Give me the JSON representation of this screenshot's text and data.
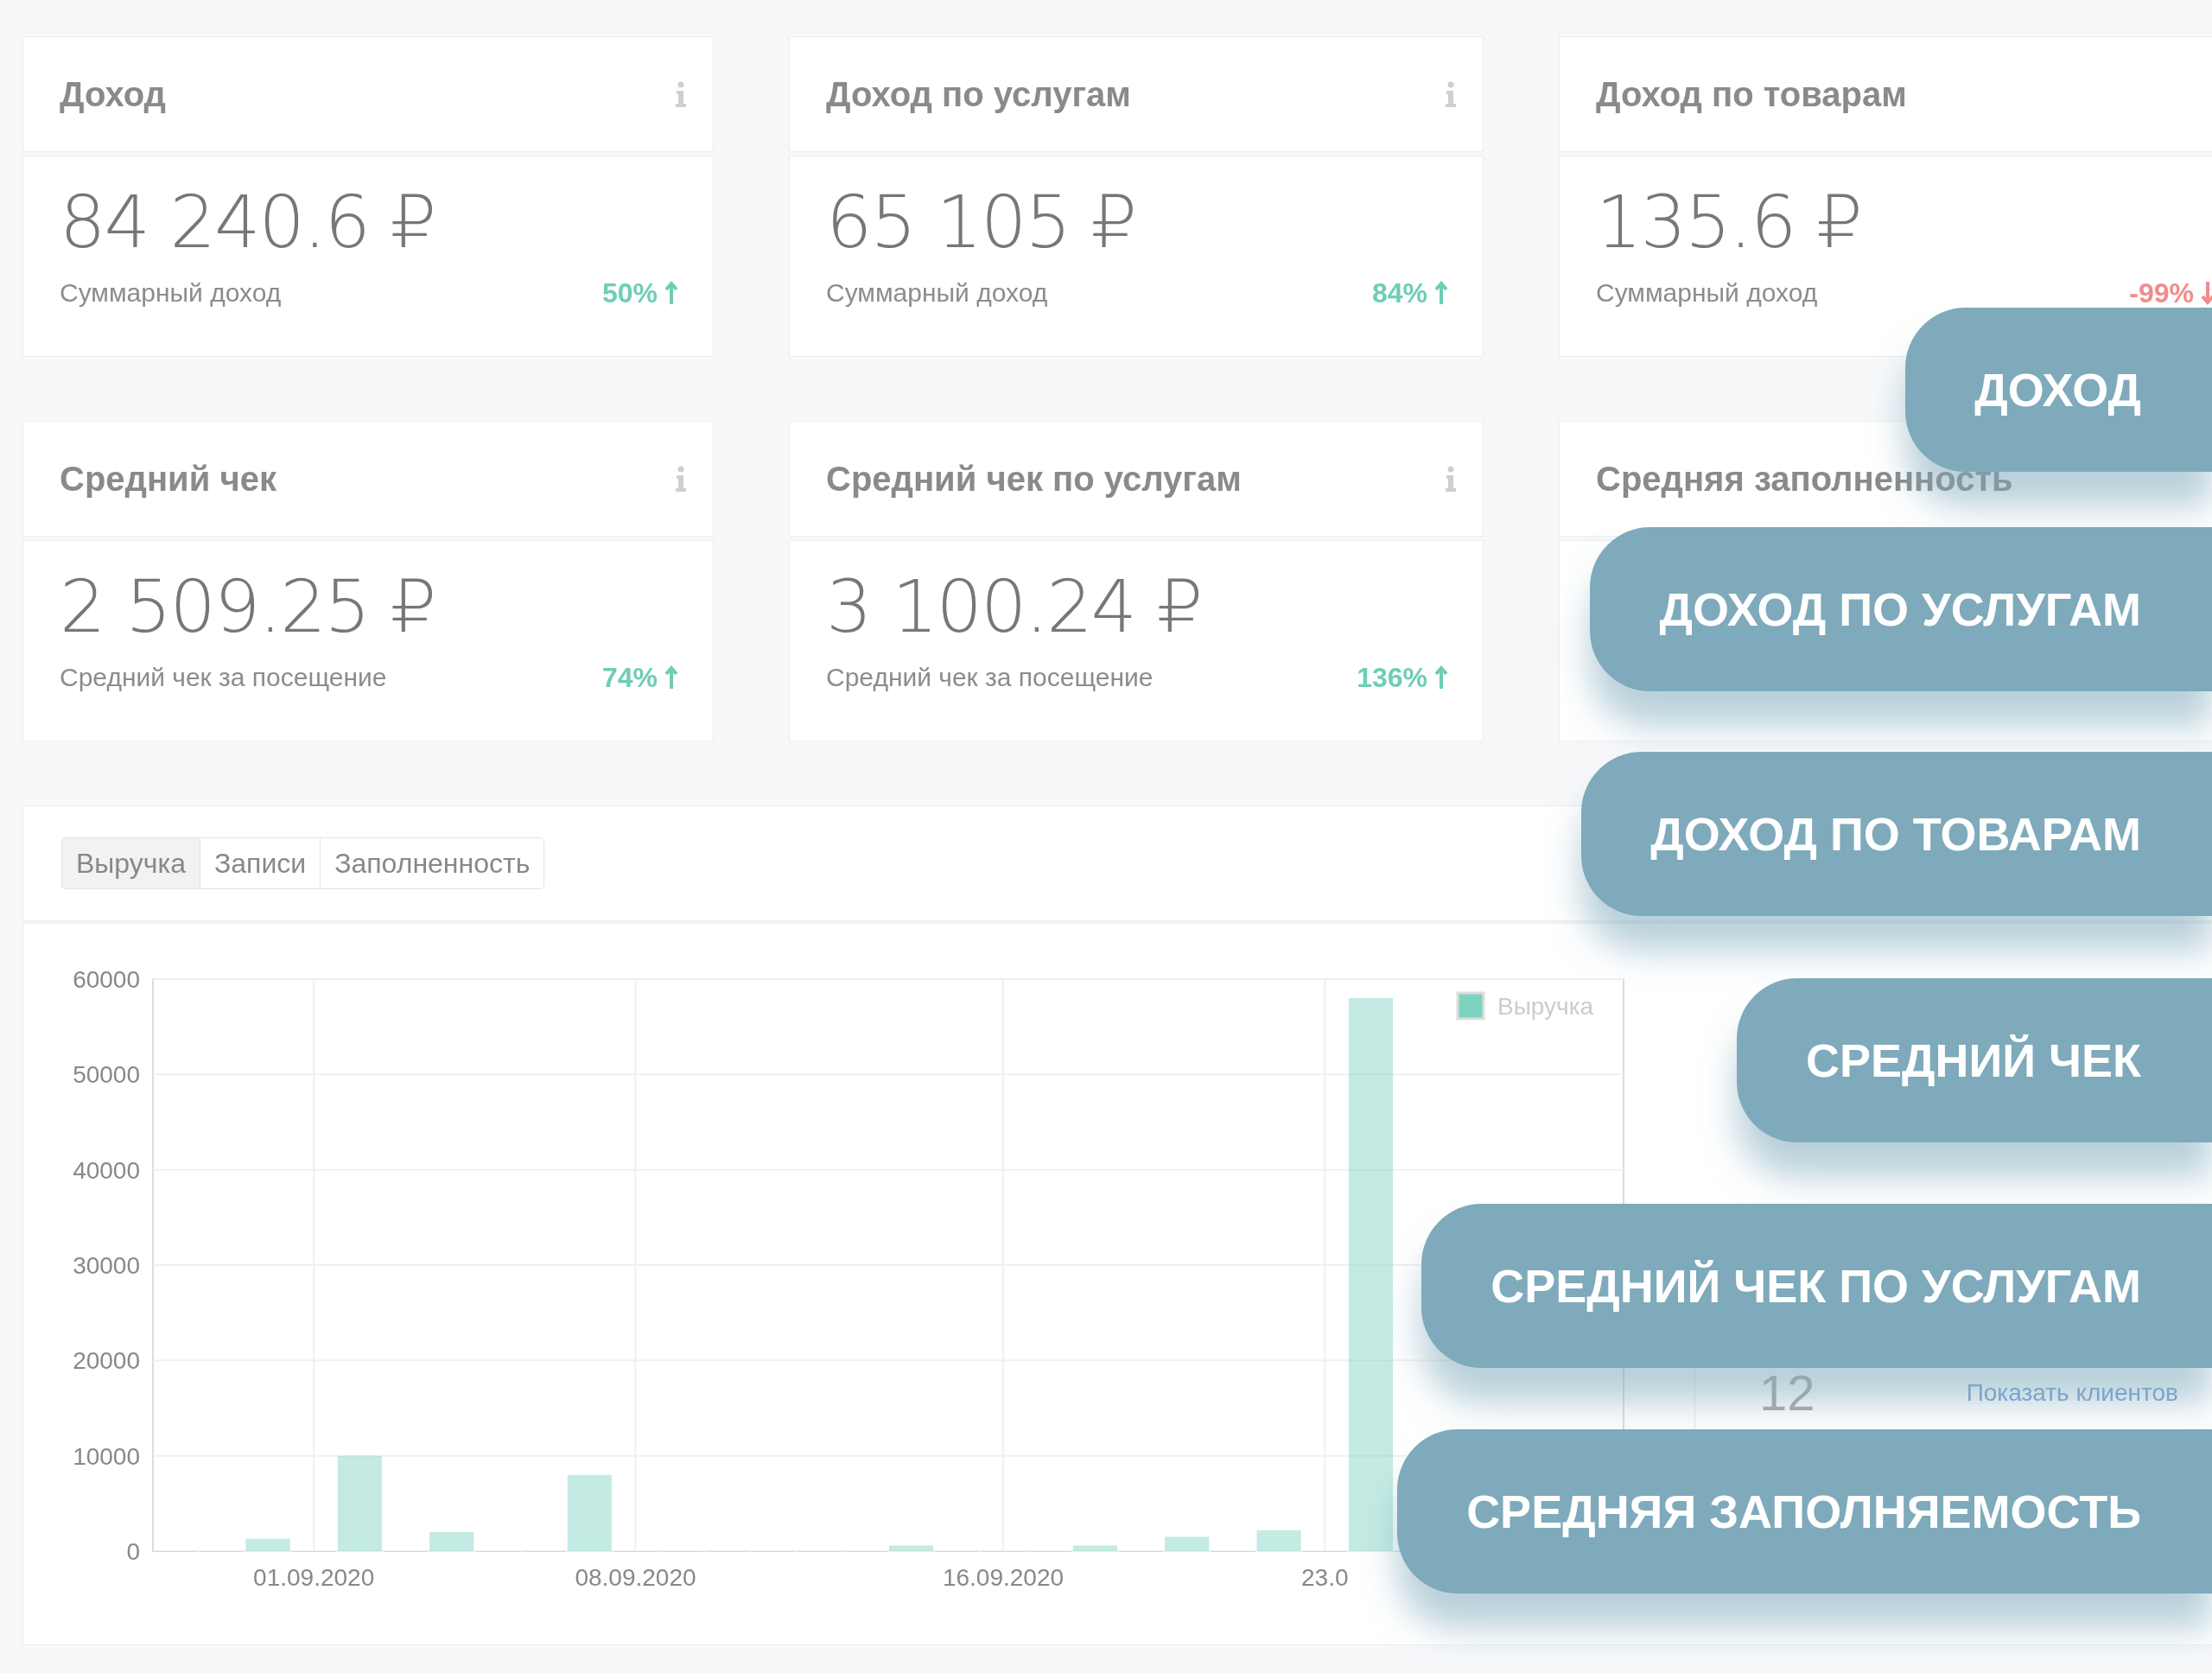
{
  "cards": [
    {
      "title": "Доход",
      "value": "84 240.6 ₽",
      "caption": "Суммарный доход",
      "change": "50%",
      "kind": "up"
    },
    {
      "title": "Доход по услугам",
      "value": "65 105 ₽",
      "caption": "Суммарный доход",
      "change": "84%",
      "kind": "up"
    },
    {
      "title": "Доход по товарам",
      "value": "135.6 ₽",
      "caption": "Суммарный доход",
      "change": "-99%",
      "kind": "down"
    },
    {
      "title": "Средний чек",
      "value": "2 509.25 ₽",
      "caption": "Средний чек за посещение",
      "change": "74%",
      "kind": "up"
    },
    {
      "title": "Средний чек по услугам",
      "value": "3 100.24 ₽",
      "caption": "Средний чек за посещение",
      "change": "136%",
      "kind": "up"
    },
    {
      "title": "Средняя заполненность"
    }
  ],
  "chart_panel": {
    "tabs": [
      {
        "label": "Выручка",
        "selected": true
      },
      {
        "label": "Записи",
        "selected": false
      },
      {
        "label": "Заполненность",
        "selected": false
      }
    ],
    "chart_data": {
      "type": "bar",
      "categories": [
        null,
        null,
        null,
        "01.09.2020",
        null,
        null,
        null,
        null,
        null,
        null,
        "08.09.2020",
        null,
        null,
        null,
        null,
        null,
        null,
        null,
        "16.09.2020",
        null,
        null,
        null,
        null,
        null,
        null,
        "23.0",
        null,
        null,
        null,
        null,
        null,
        null
      ],
      "grid": true,
      "series": [
        {
          "name": "Выручка",
          "color": "#7dd3c0",
          "values": [
            0,
            0,
            1300,
            0,
            10000,
            0,
            2000,
            0,
            0,
            8000,
            0,
            0,
            0,
            0,
            0,
            0,
            600,
            0,
            0,
            0,
            600,
            0,
            1500,
            0,
            2200,
            0,
            58000,
            0,
            0,
            0,
            0,
            0
          ]
        }
      ],
      "ylim": [
        0,
        60000
      ],
      "yticks": [
        0,
        10000,
        20000,
        30000,
        40000,
        50000,
        60000
      ]
    },
    "clients": [
      {
        "count": "12",
        "link": "Показать клиентов"
      }
    ]
  },
  "overlay_labels": [
    "ДОХОД",
    "ДОХОД ПО УСЛУГАМ",
    "ДОХОД ПО ТОВАРАМ",
    "СРЕДНИЙ ЧЕК",
    "СРЕДНИЙ ЧЕК ПО УСЛУГАМ",
    "СРЕДНЯЯ ЗАПОЛНЯЕМОСТЬ"
  ]
}
